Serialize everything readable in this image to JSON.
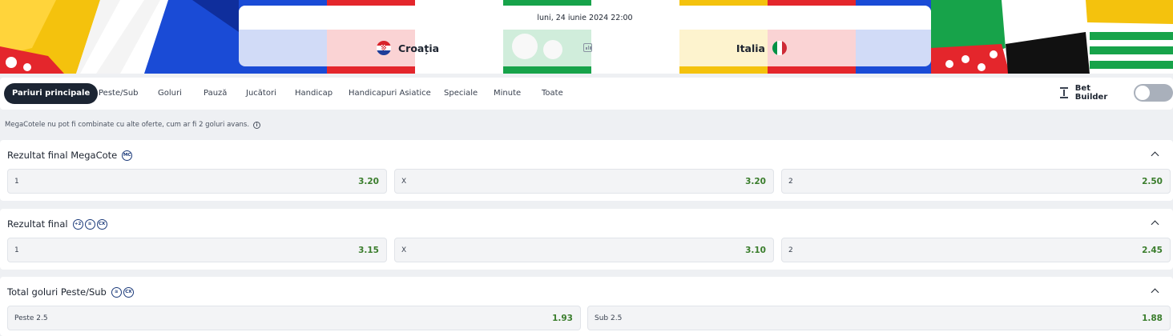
{
  "match": {
    "date": "luni, 24 iunie 2024 22:00",
    "home_team": "Croația",
    "away_team": "Italia"
  },
  "tabs": [
    {
      "label": "Pariuri principale",
      "active": true
    },
    {
      "label": "Peste/Sub"
    },
    {
      "label": "Goluri"
    },
    {
      "label": "Pauză"
    },
    {
      "label": "Jucători"
    },
    {
      "label": "Handicap"
    },
    {
      "label": "Handicapuri Asiatice"
    },
    {
      "label": "Speciale"
    },
    {
      "label": "Minute"
    },
    {
      "label": "Toate"
    }
  ],
  "bet_builder": {
    "label": "Bet Builder",
    "enabled": false
  },
  "notice": "MegaCotele nu pot fi combinate cu alte oferte, cum ar fi 2 goluri avans.",
  "markets": [
    {
      "title": "Rezultat final MegaCote",
      "badges": [
        "MC"
      ],
      "outcomes": [
        {
          "label": "1",
          "odd": "3.20"
        },
        {
          "label": "X",
          "odd": "3.20"
        },
        {
          "label": "2",
          "odd": "2.50"
        }
      ]
    },
    {
      "title": "Rezultat final",
      "badges": [
        "+2",
        "≋",
        "CX"
      ],
      "outcomes": [
        {
          "label": "1",
          "odd": "3.15"
        },
        {
          "label": "X",
          "odd": "3.10"
        },
        {
          "label": "2",
          "odd": "2.45"
        }
      ]
    },
    {
      "title": "Total goluri Peste/Sub",
      "badges": [
        "≋",
        "CX"
      ],
      "outcomes": [
        {
          "label": "Peste 2.5",
          "odd": "1.93"
        },
        {
          "label": "Sub 2.5",
          "odd": "1.88"
        }
      ]
    }
  ],
  "colors": {
    "odd_value": "#3a7d2c",
    "active_tab": "#1c2533",
    "badge": "#1c3b7a"
  }
}
